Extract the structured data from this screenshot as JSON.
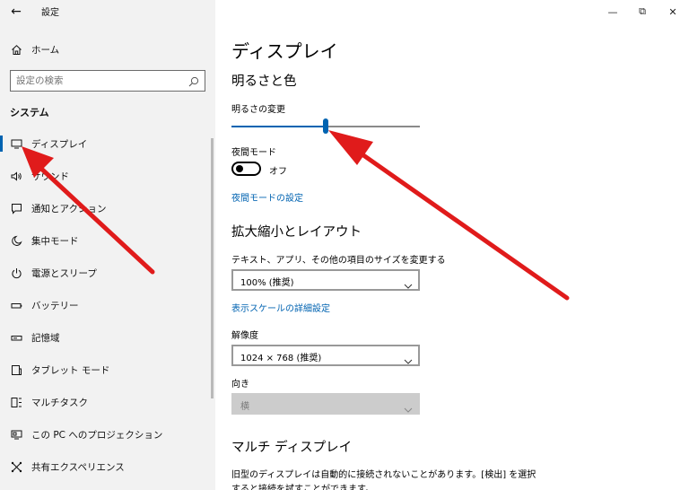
{
  "window": {
    "back_label": "←",
    "title": "設定",
    "minimize_label": "—",
    "maximize_label": "⧉",
    "close_label": "✕"
  },
  "sidebar": {
    "home_label": "ホーム",
    "search_placeholder": "設定の検索",
    "section_heading": "システム",
    "items": [
      {
        "label": "ディスプレイ",
        "icon": "monitor-icon",
        "selected": true
      },
      {
        "label": "サウンド",
        "icon": "speaker-icon"
      },
      {
        "label": "通知とアクション",
        "icon": "notification-icon"
      },
      {
        "label": "集中モード",
        "icon": "moon-icon"
      },
      {
        "label": "電源とスリープ",
        "icon": "power-icon"
      },
      {
        "label": "バッテリー",
        "icon": "battery-icon"
      },
      {
        "label": "記憶域",
        "icon": "storage-icon"
      },
      {
        "label": "タブレット モード",
        "icon": "tablet-icon"
      },
      {
        "label": "マルチタスク",
        "icon": "multitask-icon"
      },
      {
        "label": "この PC へのプロジェクション",
        "icon": "projection-icon"
      },
      {
        "label": "共有エクスペリエンス",
        "icon": "shared-experience-icon"
      }
    ]
  },
  "main": {
    "title": "ディスプレイ",
    "brightness": {
      "heading": "明るさと色",
      "change_label": "明るさの変更",
      "value_fraction": 0.5
    },
    "night_mode": {
      "label": "夜間モード",
      "state_label": "オフ",
      "settings_link": "夜間モードの設定"
    },
    "scale_layout": {
      "heading": "拡大縮小とレイアウト",
      "size_label": "テキスト、アプリ、その他の項目のサイズを変更する",
      "size_value": "100% (推奨)",
      "advanced_link": "表示スケールの詳細設定",
      "resolution_label": "解像度",
      "resolution_value": "1024 × 768 (推奨)",
      "orientation_label": "向き",
      "orientation_value": "横"
    },
    "multi_display": {
      "heading": "マルチ ディスプレイ",
      "description": "旧型のディスプレイは自動的に接続されないことがあります。[検出] を選択すると接続を試すことができます。"
    }
  },
  "colors": {
    "accent": "#0063b1",
    "sidebar_bg": "#f2f2f2",
    "arrow": "#e01b1b"
  }
}
